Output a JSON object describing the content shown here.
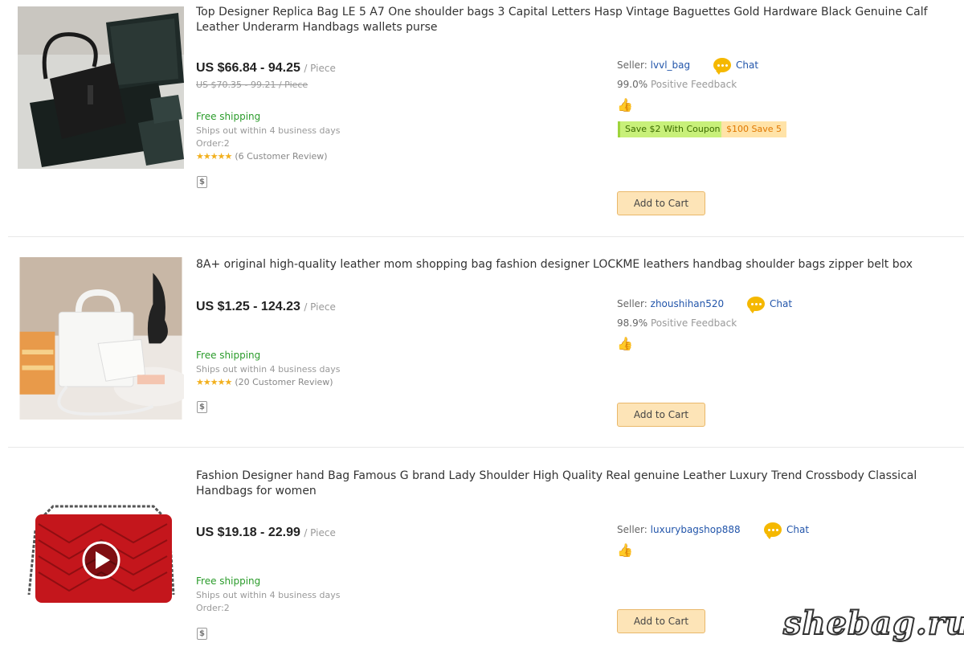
{
  "items": [
    {
      "title": "Top Designer Replica Bag LE 5 A7 One shoulder bags 3 Capital Letters Hasp Vintage Baguettes Gold Hardware Black Genuine Calf Leather Underarm Handbags wallets purse",
      "price": "US $66.84 - 94.25",
      "price_unit": "/ Piece",
      "old_price": "US $70.35 - 99.21 / Piece",
      "shipping": "Free shipping",
      "ships_out": "Ships out within 4 business days",
      "order": "Order:2",
      "stars": "★★★★★",
      "reviews": "(6 Customer Review)",
      "seller_label": "Seller:",
      "seller_name": "lvvl_bag",
      "chat_label": "Chat",
      "feedback_value": "99.0%",
      "feedback_label": "Positive Feedback",
      "coupon_green": "Save $2 With Coupon",
      "coupon_orange": "$100 Save 5",
      "cart_label": "Add to Cart",
      "dollar_icon": "$",
      "thumb_icon": "👍"
    },
    {
      "title": "8A+ original high-quality leather mom shopping bag fashion designer LOCKME leathers handbag shoulder bags zipper belt box",
      "price": "US $1.25 - 124.23",
      "price_unit": "/ Piece",
      "shipping": "Free shipping",
      "ships_out": "Ships out within 4 business days",
      "stars": "★★★★★",
      "reviews": "(20 Customer Review)",
      "seller_label": "Seller:",
      "seller_name": "zhoushihan520",
      "chat_label": "Chat",
      "feedback_value": "98.9%",
      "feedback_label": "Positive Feedback",
      "cart_label": "Add to Cart",
      "dollar_icon": "$",
      "thumb_icon": "👍"
    },
    {
      "title": "Fashion Designer hand Bag Famous G brand Lady Shoulder High Quality Real genuine Leather Luxury Trend Crossbody Classical Handbags for women",
      "price": "US $19.18 - 22.99",
      "price_unit": "/ Piece",
      "shipping": "Free shipping",
      "ships_out": "Ships out within 4 business days",
      "order": "Order:2",
      "seller_label": "Seller:",
      "seller_name": "luxurybagshop888",
      "chat_label": "Chat",
      "cart_label": "Add to Cart",
      "dollar_icon": "$",
      "thumb_icon": "👍"
    }
  ],
  "watermark": "shebag.ru"
}
